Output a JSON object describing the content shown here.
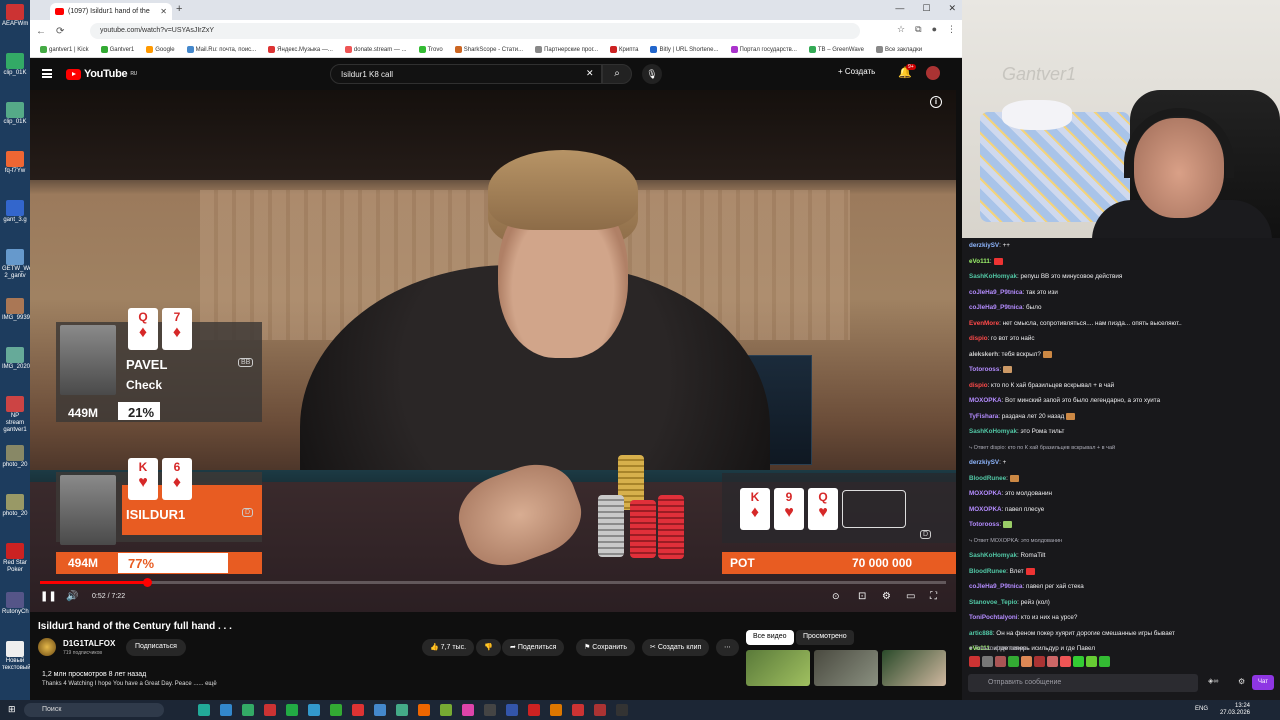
{
  "desktop": {
    "icons": [
      "AEAFWm",
      "clip_01K",
      "clip_01K",
      "fq-f7Yw",
      "gant_3.g",
      "GETW_Wel 2_gantv",
      "IMG_9939",
      "IMG_2020",
      "NP stream gantver1",
      "photo_20",
      "photo_20",
      "Red Star Poker",
      "RutonyCh",
      "Новый текстовый"
    ]
  },
  "browser": {
    "tab_title": "(1097) Isildur1 hand of the",
    "url": "youtube.com/watch?v=USYAsJIrZxY",
    "bookmarks": [
      "gantver1 | Kick",
      "Gantver1",
      "Google",
      "Mail.Ru: почта, поис...",
      "Яндекс.Музыка —...",
      "donate.stream — ...",
      "Trovo",
      "SharkScope - Стати...",
      "Партнерские прог...",
      "Крипта",
      "Bitly | URL Shortene...",
      "Портал государств...",
      "TB – GreenWave",
      "Все закладки"
    ],
    "window_controls": [
      "—",
      "☐",
      "✕"
    ]
  },
  "youtube": {
    "logo": "YouTube",
    "logo_region": "RU",
    "search_query": "Isildur1 K8 call",
    "create_label": "Создать",
    "notif_count": "9+"
  },
  "overlay": {
    "player1": {
      "name": "PAVEL",
      "action": "Check",
      "stack": "449M",
      "equity": "21%",
      "badge": "BB",
      "cards": [
        {
          "rank": "Q",
          "suit": "♦"
        },
        {
          "rank": "7",
          "suit": "♦"
        }
      ]
    },
    "player2": {
      "name": "ISILDUR1",
      "stack": "494M",
      "equity": "77%",
      "badge": "D",
      "cards": [
        {
          "rank": "K",
          "suit": "♥"
        },
        {
          "rank": "6",
          "suit": "♦"
        }
      ]
    },
    "board": [
      {
        "rank": "K",
        "suit": "♦"
      },
      {
        "rank": "9",
        "suit": "♥"
      },
      {
        "rank": "Q",
        "suit": "♥"
      }
    ],
    "pot_label": "POT",
    "pot_value": "70 000 000",
    "dealer_badge": "D",
    "screen_text": "ver"
  },
  "player": {
    "time": "0:52 / 7:22",
    "progress": 0.118
  },
  "video": {
    "title": "Isildur1 hand of the Century full hand . . .",
    "channel": "D1G1TALFOX",
    "subscribers": "719 подписчиков",
    "subscribe_label": "Подписаться",
    "likes": "7,7 тыс.",
    "share_label": "Поделиться",
    "save_label": "Сохранить",
    "clip_label": "Создать клип",
    "views_line": "1,2 млн просмотров  8 лет назад",
    "description": "Thanks 4 Watching I hope You have a Great Day. Peace    ......  ещё",
    "chip_all": "Все видео",
    "chip_viewed": "Просмотрено"
  },
  "chat": {
    "wall_text": "Gantver1",
    "messages": [
      {
        "user": "derzkiySV",
        "color": "#8fb7ff",
        "text": ": ++"
      },
      {
        "user": "eVo111",
        "color": "#9df56c",
        "text": ":"
      },
      {
        "user": "SashKoHomyak",
        "color": "#52c8a6",
        "text": ": репуш ВВ это минусовое действия"
      },
      {
        "user": "coJleHa9_P9tnica",
        "color": "#b48cff",
        "text": ": так это изи"
      },
      {
        "user": "coJleHa9_P9tnica",
        "color": "#b48cff",
        "text": ": было"
      },
      {
        "user": "EvenMore",
        "color": "#ff4a4a",
        "text": ": нет смысла, сопротивляться.... нам пизда... опять выселяют.."
      },
      {
        "user": "dispio",
        "color": "#ff4a4a",
        "text": ": го вот это найс"
      },
      {
        "user": "alekskerh",
        "color": "#cfcfcf",
        "text": ": тебя вскрыл?"
      },
      {
        "user": "Totorooss",
        "color": "#b48cff",
        "text": ":"
      },
      {
        "user": "dispio",
        "color": "#ff4a4a",
        "text": ": кто по К хай бразильцев вскрывал + в чай"
      },
      {
        "user": "MOXOPKA",
        "color": "#b48cff",
        "text": ": Вот минский запой это было легендарно, а это хуита"
      },
      {
        "user": "TyFishara",
        "color": "#b48cff",
        "text": ": раздача лет 20 назад"
      },
      {
        "user": "SashKoHomyak",
        "color": "#52c8a6",
        "text": ": это Рома тильт"
      },
      {
        "user": "",
        "color": "#adadb8",
        "text": "⤷ Ответ dispio: кто по К хай бразильцев вскрывал + в чай",
        "system": true
      },
      {
        "user": "derzkiySV",
        "color": "#8fb7ff",
        "text": ": +"
      },
      {
        "user": "BloodRunee",
        "color": "#52c8a6",
        "text": ":"
      },
      {
        "user": "MOXOPKA",
        "color": "#b48cff",
        "text": ": это молдованин"
      },
      {
        "user": "MOXOPKA",
        "color": "#b48cff",
        "text": ": павел плесуе"
      },
      {
        "user": "Totorooss",
        "color": "#b48cff",
        "text": ":"
      },
      {
        "user": "",
        "color": "#adadb8",
        "text": "⤷ Ответ MOXOPKA: это молдованин",
        "system": true
      },
      {
        "user": "SashKoHomyak",
        "color": "#52c8a6",
        "text": ": RomaTilt"
      },
      {
        "user": "BloodRunee",
        "color": "#52c8a6",
        "text": ": Влет"
      },
      {
        "user": "coJleHa9_P9tnica",
        "color": "#b48cff",
        "text": ": павел рег хай стека"
      },
      {
        "user": "Stanovoe_Tepio",
        "color": "#52c8a6",
        "text": ": рейз (кол)"
      },
      {
        "user": "ToniPochtalyoni",
        "color": "#b48cff",
        "text": ": кто из них на урсе?"
      },
      {
        "user": "artic888",
        "color": "#52c8a6",
        "text": ": Он на феном покер хуярит дорогие смешанные игры бывает"
      },
      {
        "user": "eVo111",
        "color": "#9df56c",
        "text": ": и где теперь исильдур и где Павел"
      }
    ],
    "followers_label": "♥ Только фолловеры",
    "input_placeholder": "Отправить сообщение",
    "send_label": "Чат"
  },
  "taskbar": {
    "search_placeholder": "Поиск",
    "lang": "ENG",
    "time": "13:24",
    "date": "27.03.2026"
  }
}
